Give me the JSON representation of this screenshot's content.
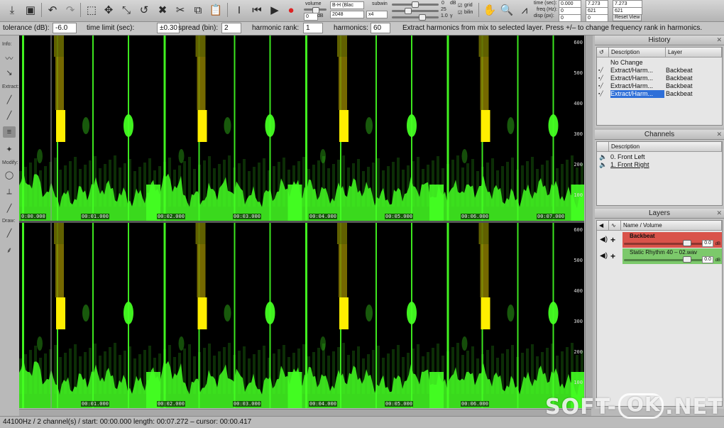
{
  "toolbar": {
    "icons": [
      "import-icon",
      "save-icon",
      "undo-icon",
      "redo-icon",
      "rect-select-icon",
      "move-icon",
      "resize-icon",
      "lasso-icon",
      "delete-icon",
      "cut-icon",
      "copy-icon",
      "paste-icon",
      "cursor-icon",
      "rewind-icon",
      "play-icon",
      "record-icon",
      "hand-icon",
      "zoom-icon",
      "frequency-icon"
    ],
    "volume_label": "volume",
    "volume_value": "0",
    "volume_unit": "dB",
    "window_select": "B-H (Blac",
    "fft_select": "2048",
    "overlap_select": "x4",
    "subwin_label": "subwin",
    "slider_db_top": "0",
    "slider_db_unit": "dB",
    "slider_db_value": "25",
    "gamma_value": "1.0",
    "gamma_unit": "γ",
    "grid_label": "grid",
    "bilin_label": "bilin",
    "time_label": "time (sec):",
    "freq_label": "freq (Hz):",
    "disp_label": "disp (px):",
    "time_from": "0.000",
    "time_to": "7.273",
    "time_to2": "7.273",
    "freq_from": "0",
    "freq_to": "621",
    "freq_to2": "621",
    "disp_from": "0",
    "disp_to": "0",
    "reset_view": "Reset View"
  },
  "options": {
    "tolerance_label": "tolerance (dB):",
    "tolerance_value": "-6.0",
    "time_limit_label": "time limit (sec):",
    "time_limit_value": "±0.30",
    "spread_label": "spread (bin):",
    "spread_value": "2",
    "harmonic_rank_label": "harmonic rank:",
    "harmonic_rank_value": "1",
    "harmonics_label": "harmonics:",
    "harmonics_value": "60",
    "hint": "Extract harmonics from mix to selected layer. Press +/– to change frequency rank in harmonics."
  },
  "palette": {
    "info_label": "Info:",
    "extract_label": "Extract:",
    "modify_label": "Modify:",
    "draw_label": "Draw:"
  },
  "spectrogram": {
    "time_labels": [
      "0:00.000",
      "00:01.000",
      "00:02.000",
      "00:03.000",
      "00:04.000",
      "00:05.000",
      "00:06.000",
      "00:07.000"
    ],
    "time_labels_bottom": [
      "00:01.000",
      "00:02.000",
      "00:03.000",
      "00:04.000",
      "00:05.000",
      "00:06.000"
    ],
    "freq_labels": [
      "600",
      "500",
      "400",
      "300",
      "200",
      "100"
    ],
    "colors": {
      "background": "#000000",
      "energy": "#44ff22",
      "peak": "#ffee00"
    }
  },
  "history": {
    "title": "History",
    "col_description": "Description",
    "col_layer": "Layer",
    "rows": [
      {
        "description": "No Change",
        "layer": ""
      },
      {
        "description": "Extract/Harm...",
        "layer": "Backbeat"
      },
      {
        "description": "Extract/Harm...",
        "layer": "Backbeat"
      },
      {
        "description": "Extract/Harm...",
        "layer": "Backbeat"
      },
      {
        "description": "Extract/Harm...",
        "layer": "Backbeat"
      }
    ]
  },
  "channels": {
    "title": "Channels",
    "col_description": "Description",
    "rows": [
      "0. Front Left",
      "1. Front Right"
    ]
  },
  "layers": {
    "title": "Layers",
    "col_name": "Name / Volume",
    "rows": [
      {
        "name": "Backbeat",
        "volume": "0.0",
        "unit": "dB",
        "level": 0.85,
        "color": "#d9534a"
      },
      {
        "name": "Static Rhythm 40 – 02.wav",
        "volume": "0.0",
        "unit": "dB",
        "level": 0.85,
        "color": "#7cc96b"
      }
    ]
  },
  "status": {
    "text": "44100Hz / 2 channel(s) / start: 00:00.000 length: 00:07.272 – cursor: 00:00.417"
  },
  "watermark": {
    "left": "SOFT-",
    "right": ".NET",
    "mid": "OK"
  }
}
